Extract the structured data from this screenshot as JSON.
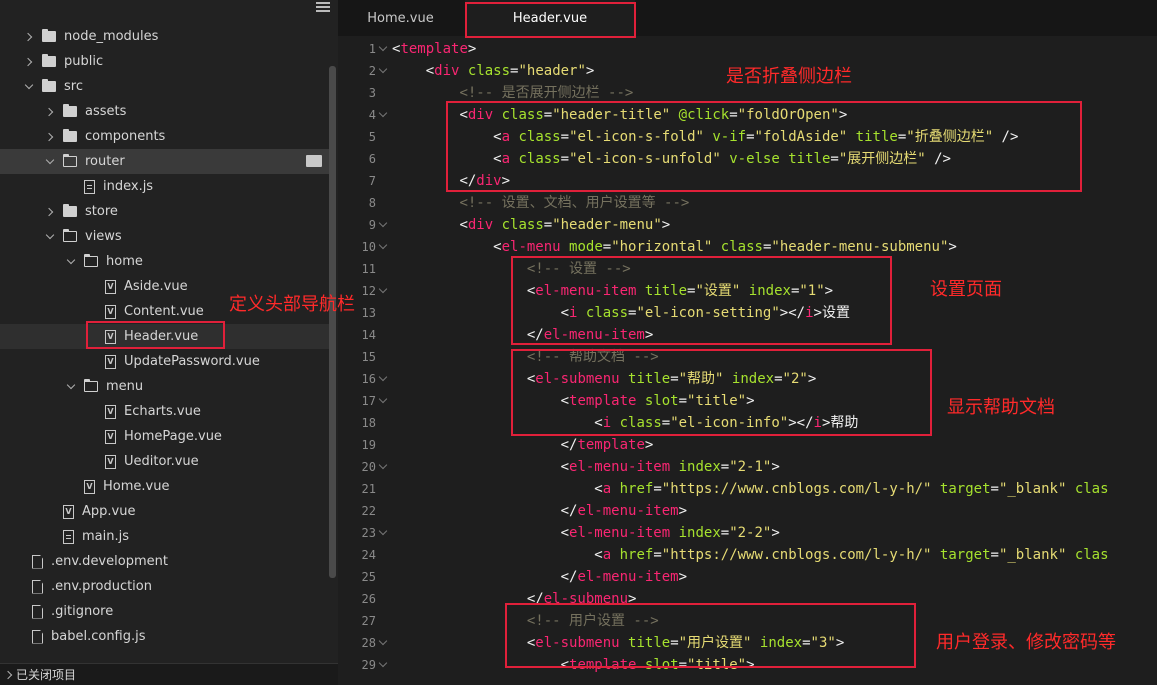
{
  "sidebar": {
    "tree": [
      {
        "label": "node_modules",
        "kind": "folder",
        "chev": "closed",
        "depth": 0
      },
      {
        "label": "public",
        "kind": "folder",
        "chev": "closed",
        "depth": 0
      },
      {
        "label": "src",
        "kind": "folder",
        "chev": "open",
        "depth": 0
      },
      {
        "label": "assets",
        "kind": "folder",
        "chev": "closed",
        "depth": 1
      },
      {
        "label": "components",
        "kind": "folder",
        "chev": "closed",
        "depth": 1
      },
      {
        "label": "router",
        "kind": "folder-open",
        "chev": "open",
        "depth": 1
      },
      {
        "label": "index.js",
        "kind": "js",
        "chev": "none",
        "depth": 2
      },
      {
        "label": "store",
        "kind": "folder",
        "chev": "closed",
        "depth": 1
      },
      {
        "label": "views",
        "kind": "folder-open",
        "chev": "open",
        "depth": 1
      },
      {
        "label": "home",
        "kind": "folder-open",
        "chev": "open",
        "depth": 2
      },
      {
        "label": "Aside.vue",
        "kind": "vue",
        "chev": "none",
        "depth": 3
      },
      {
        "label": "Content.vue",
        "kind": "vue",
        "chev": "none",
        "depth": 3
      },
      {
        "label": "Header.vue",
        "kind": "vue",
        "chev": "none",
        "depth": 3
      },
      {
        "label": "UpdatePassword.vue",
        "kind": "vue",
        "chev": "none",
        "depth": 3
      },
      {
        "label": "menu",
        "kind": "folder-open",
        "chev": "open",
        "depth": 2
      },
      {
        "label": "Echarts.vue",
        "kind": "vue",
        "chev": "none",
        "depth": 3
      },
      {
        "label": "HomePage.vue",
        "kind": "vue",
        "chev": "none",
        "depth": 3
      },
      {
        "label": "Ueditor.vue",
        "kind": "vue",
        "chev": "none",
        "depth": 3
      },
      {
        "label": "Home.vue",
        "kind": "vue",
        "chev": "none",
        "depth": 2
      },
      {
        "label": "App.vue",
        "kind": "vue",
        "chev": "none",
        "depth": 1
      },
      {
        "label": "main.js",
        "kind": "js",
        "chev": "none",
        "depth": 1
      },
      {
        "label": ".env.development",
        "kind": "plain",
        "chev": "none",
        "depth": 0
      },
      {
        "label": ".env.production",
        "kind": "plain",
        "chev": "none",
        "depth": 0
      },
      {
        "label": ".gitignore",
        "kind": "plain",
        "chev": "none",
        "depth": 0
      },
      {
        "label": "babel.config.js",
        "kind": "plain",
        "chev": "none",
        "depth": 0
      }
    ],
    "footer_label": "已关闭项目"
  },
  "tabs": [
    {
      "label": "Home.vue",
      "active": false
    },
    {
      "label": "Header.vue",
      "active": true
    }
  ],
  "code": [
    {
      "n": "1",
      "parts": [
        [
          "tag",
          "<"
        ],
        [
          "tg",
          "template"
        ],
        [
          "tag",
          ">"
        ]
      ]
    },
    {
      "n": "2",
      "parts": [
        [
          "t",
          "    "
        ],
        [
          "tag",
          "<"
        ],
        [
          "tg",
          "div"
        ],
        [
          "t",
          " "
        ],
        [
          "at",
          "class"
        ],
        [
          "t",
          "="
        ],
        [
          "st",
          "\"header\""
        ],
        [
          "tag",
          ">"
        ]
      ]
    },
    {
      "n": "3",
      "parts": [
        [
          "t",
          "        "
        ],
        [
          "cm",
          "<!-- 是否展开侧边栏 -->"
        ]
      ]
    },
    {
      "n": "4",
      "parts": [
        [
          "t",
          "        "
        ],
        [
          "tag",
          "<"
        ],
        [
          "tg",
          "div"
        ],
        [
          "t",
          " "
        ],
        [
          "at",
          "class"
        ],
        [
          "t",
          "="
        ],
        [
          "st",
          "\"header-title\""
        ],
        [
          "t",
          " "
        ],
        [
          "at",
          "@click"
        ],
        [
          "t",
          "="
        ],
        [
          "st",
          "\"foldOrOpen\""
        ],
        [
          "tag",
          ">"
        ]
      ]
    },
    {
      "n": "5",
      "parts": [
        [
          "t",
          "            "
        ],
        [
          "tag",
          "<"
        ],
        [
          "tg",
          "a"
        ],
        [
          "t",
          " "
        ],
        [
          "at",
          "class"
        ],
        [
          "t",
          "="
        ],
        [
          "st",
          "\"el-icon-s-fold\""
        ],
        [
          "t",
          " "
        ],
        [
          "at",
          "v-if"
        ],
        [
          "t",
          "="
        ],
        [
          "st",
          "\"foldAside\""
        ],
        [
          "t",
          " "
        ],
        [
          "at",
          "title"
        ],
        [
          "t",
          "="
        ],
        [
          "st",
          "\"折叠侧边栏\""
        ],
        [
          "t",
          " />"
        ]
      ]
    },
    {
      "n": "6",
      "parts": [
        [
          "t",
          "            "
        ],
        [
          "tag",
          "<"
        ],
        [
          "tg",
          "a"
        ],
        [
          "t",
          " "
        ],
        [
          "at",
          "class"
        ],
        [
          "t",
          "="
        ],
        [
          "st",
          "\"el-icon-s-unfold\""
        ],
        [
          "t",
          " "
        ],
        [
          "at",
          "v-else"
        ],
        [
          "t",
          " "
        ],
        [
          "at",
          "title"
        ],
        [
          "t",
          "="
        ],
        [
          "st",
          "\"展开侧边栏\""
        ],
        [
          "t",
          " />"
        ]
      ]
    },
    {
      "n": "7",
      "parts": [
        [
          "t",
          "        "
        ],
        [
          "tag",
          "</"
        ],
        [
          "tg",
          "div"
        ],
        [
          "tag",
          ">"
        ]
      ]
    },
    {
      "n": "8",
      "parts": [
        [
          "t",
          "        "
        ],
        [
          "cm",
          "<!-- 设置、文档、用户设置等 -->"
        ]
      ]
    },
    {
      "n": "9",
      "parts": [
        [
          "t",
          "        "
        ],
        [
          "tag",
          "<"
        ],
        [
          "tg",
          "div"
        ],
        [
          "t",
          " "
        ],
        [
          "at",
          "class"
        ],
        [
          "t",
          "="
        ],
        [
          "st",
          "\"header-menu\""
        ],
        [
          "tag",
          ">"
        ]
      ]
    },
    {
      "n": "10",
      "parts": [
        [
          "t",
          "            "
        ],
        [
          "tag",
          "<"
        ],
        [
          "tg",
          "el-menu"
        ],
        [
          "t",
          " "
        ],
        [
          "at",
          "mode"
        ],
        [
          "t",
          "="
        ],
        [
          "st",
          "\"horizontal\""
        ],
        [
          "t",
          " "
        ],
        [
          "at",
          "class"
        ],
        [
          "t",
          "="
        ],
        [
          "st",
          "\"header-menu-submenu\""
        ],
        [
          "tag",
          ">"
        ]
      ]
    },
    {
      "n": "11",
      "parts": [
        [
          "t",
          "                "
        ],
        [
          "cm",
          "<!-- 设置 -->"
        ]
      ]
    },
    {
      "n": "12",
      "parts": [
        [
          "t",
          "                "
        ],
        [
          "tag",
          "<"
        ],
        [
          "tg",
          "el-menu-item"
        ],
        [
          "t",
          " "
        ],
        [
          "at",
          "title"
        ],
        [
          "t",
          "="
        ],
        [
          "st",
          "\"设置\""
        ],
        [
          "t",
          " "
        ],
        [
          "at",
          "index"
        ],
        [
          "t",
          "="
        ],
        [
          "st",
          "\"1\""
        ],
        [
          "tag",
          ">"
        ]
      ]
    },
    {
      "n": "13",
      "parts": [
        [
          "t",
          "                    "
        ],
        [
          "tag",
          "<"
        ],
        [
          "tg",
          "i"
        ],
        [
          "t",
          " "
        ],
        [
          "at",
          "class"
        ],
        [
          "t",
          "="
        ],
        [
          "st",
          "\"el-icon-setting\""
        ],
        [
          "tag",
          "></"
        ],
        [
          "tg",
          "i"
        ],
        [
          "tag",
          ">"
        ],
        [
          "t",
          "设置"
        ]
      ]
    },
    {
      "n": "14",
      "parts": [
        [
          "t",
          "                "
        ],
        [
          "tag",
          "</"
        ],
        [
          "tg",
          "el-menu-item"
        ],
        [
          "tag",
          ">"
        ]
      ]
    },
    {
      "n": "15",
      "parts": [
        [
          "t",
          "                "
        ],
        [
          "cm",
          "<!-- 帮助文档 -->"
        ]
      ]
    },
    {
      "n": "16",
      "parts": [
        [
          "t",
          "                "
        ],
        [
          "tag",
          "<"
        ],
        [
          "tg",
          "el-submenu"
        ],
        [
          "t",
          " "
        ],
        [
          "at",
          "title"
        ],
        [
          "t",
          "="
        ],
        [
          "st",
          "\"帮助\""
        ],
        [
          "t",
          " "
        ],
        [
          "at",
          "index"
        ],
        [
          "t",
          "="
        ],
        [
          "st",
          "\"2\""
        ],
        [
          "tag",
          ">"
        ]
      ]
    },
    {
      "n": "17",
      "parts": [
        [
          "t",
          "                    "
        ],
        [
          "tag",
          "<"
        ],
        [
          "tg",
          "template"
        ],
        [
          "t",
          " "
        ],
        [
          "at",
          "slot"
        ],
        [
          "t",
          "="
        ],
        [
          "st",
          "\"title\""
        ],
        [
          "tag",
          ">"
        ]
      ]
    },
    {
      "n": "18",
      "parts": [
        [
          "t",
          "                        "
        ],
        [
          "tag",
          "<"
        ],
        [
          "tg",
          "i"
        ],
        [
          "t",
          " "
        ],
        [
          "at",
          "class"
        ],
        [
          "t",
          "="
        ],
        [
          "st",
          "\"el-icon-info\""
        ],
        [
          "tag",
          "></"
        ],
        [
          "tg",
          "i"
        ],
        [
          "tag",
          ">"
        ],
        [
          "t",
          "帮助"
        ]
      ]
    },
    {
      "n": "19",
      "parts": [
        [
          "t",
          "                    "
        ],
        [
          "tag",
          "</"
        ],
        [
          "tg",
          "template"
        ],
        [
          "tag",
          ">"
        ]
      ]
    },
    {
      "n": "20",
      "parts": [
        [
          "t",
          "                    "
        ],
        [
          "tag",
          "<"
        ],
        [
          "tg",
          "el-menu-item"
        ],
        [
          "t",
          " "
        ],
        [
          "at",
          "index"
        ],
        [
          "t",
          "="
        ],
        [
          "st",
          "\"2-1\""
        ],
        [
          "tag",
          ">"
        ]
      ]
    },
    {
      "n": "21",
      "parts": [
        [
          "t",
          "                        "
        ],
        [
          "tag",
          "<"
        ],
        [
          "tg",
          "a"
        ],
        [
          "t",
          " "
        ],
        [
          "at",
          "href"
        ],
        [
          "t",
          "="
        ],
        [
          "st",
          "\"https://www.cnblogs.com/l-y-h/\""
        ],
        [
          "t",
          " "
        ],
        [
          "at",
          "target"
        ],
        [
          "t",
          "="
        ],
        [
          "st",
          "\"_blank\""
        ],
        [
          "t",
          " "
        ],
        [
          "at",
          "clas"
        ]
      ]
    },
    {
      "n": "22",
      "parts": [
        [
          "t",
          "                    "
        ],
        [
          "tag",
          "</"
        ],
        [
          "tg",
          "el-menu-item"
        ],
        [
          "tag",
          ">"
        ]
      ]
    },
    {
      "n": "23",
      "parts": [
        [
          "t",
          "                    "
        ],
        [
          "tag",
          "<"
        ],
        [
          "tg",
          "el-menu-item"
        ],
        [
          "t",
          " "
        ],
        [
          "at",
          "index"
        ],
        [
          "t",
          "="
        ],
        [
          "st",
          "\"2-2\""
        ],
        [
          "tag",
          ">"
        ]
      ]
    },
    {
      "n": "24",
      "parts": [
        [
          "t",
          "                        "
        ],
        [
          "tag",
          "<"
        ],
        [
          "tg",
          "a"
        ],
        [
          "t",
          " "
        ],
        [
          "at",
          "href"
        ],
        [
          "t",
          "="
        ],
        [
          "st",
          "\"https://www.cnblogs.com/l-y-h/\""
        ],
        [
          "t",
          " "
        ],
        [
          "at",
          "target"
        ],
        [
          "t",
          "="
        ],
        [
          "st",
          "\"_blank\""
        ],
        [
          "t",
          " "
        ],
        [
          "at",
          "clas"
        ]
      ]
    },
    {
      "n": "25",
      "parts": [
        [
          "t",
          "                    "
        ],
        [
          "tag",
          "</"
        ],
        [
          "tg",
          "el-menu-item"
        ],
        [
          "tag",
          ">"
        ]
      ]
    },
    {
      "n": "26",
      "parts": [
        [
          "t",
          "                "
        ],
        [
          "tag",
          "</"
        ],
        [
          "tg",
          "el-submenu"
        ],
        [
          "tag",
          ">"
        ]
      ]
    },
    {
      "n": "27",
      "parts": [
        [
          "t",
          "                "
        ],
        [
          "cm",
          "<!-- 用户设置 -->"
        ]
      ]
    },
    {
      "n": "28",
      "parts": [
        [
          "t",
          "                "
        ],
        [
          "tag",
          "<"
        ],
        [
          "tg",
          "el-submenu"
        ],
        [
          "t",
          " "
        ],
        [
          "at",
          "title"
        ],
        [
          "t",
          "="
        ],
        [
          "st",
          "\"用户设置\""
        ],
        [
          "t",
          " "
        ],
        [
          "at",
          "index"
        ],
        [
          "t",
          "="
        ],
        [
          "st",
          "\"3\""
        ],
        [
          "tag",
          ">"
        ]
      ]
    },
    {
      "n": "29",
      "parts": [
        [
          "t",
          "                    "
        ],
        [
          "tag",
          "<"
        ],
        [
          "tg",
          "template"
        ],
        [
          "t",
          " "
        ],
        [
          "at",
          "slot"
        ],
        [
          "t",
          "="
        ],
        [
          "st",
          "\"title\""
        ],
        [
          "tag",
          ">"
        ]
      ]
    }
  ],
  "annotations": {
    "fold_sidebar": "是否折叠侧边栏",
    "define_header": "定义头部导航栏",
    "settings_page": "设置页面",
    "help_docs": "显示帮助文档",
    "user_login": "用户登录、修改密码等"
  },
  "colors": {
    "tag": "#f92672",
    "attr": "#a6e22e",
    "string": "#e6db74",
    "comment": "#75715e",
    "annotation": "#ff2a2a"
  }
}
